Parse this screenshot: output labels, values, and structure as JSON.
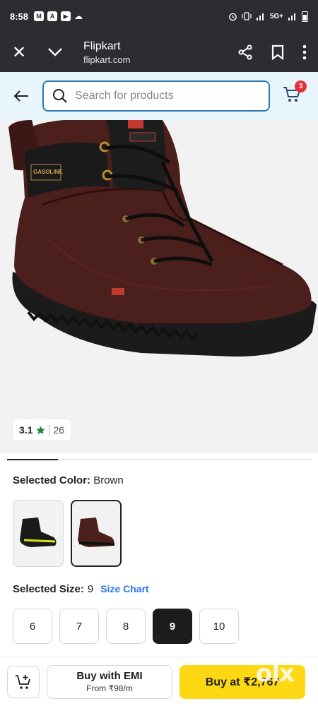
{
  "status_bar": {
    "time": "8:58",
    "notif_icons": [
      "M",
      "A",
      "▶",
      "☁"
    ],
    "right_text": "5G+"
  },
  "tab_bar": {
    "title": "Flipkart",
    "url": "flipkart.com"
  },
  "search": {
    "placeholder": "Search for products",
    "cart_count": "3"
  },
  "product": {
    "rating": "3.1",
    "rating_count": "26"
  },
  "color": {
    "label": "Selected Color:",
    "value": "Brown"
  },
  "size": {
    "label": "Selected Size:",
    "value": "9",
    "chart_label": "Size Chart",
    "options": [
      "6",
      "7",
      "8",
      "9",
      "10"
    ],
    "selected": "9"
  },
  "bottom": {
    "emi_title": "Buy with EMI",
    "emi_sub": "From ₹98/m",
    "buy_label": "Buy at ₹2,767",
    "watermark": "olx"
  }
}
